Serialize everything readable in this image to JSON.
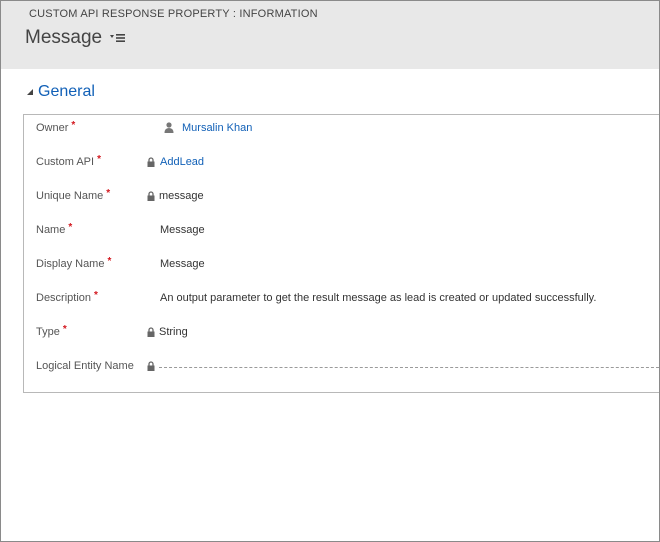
{
  "header": {
    "entity_label": "CUSTOM API RESPONSE PROPERTY : INFORMATION",
    "record_title": "Message"
  },
  "section": {
    "title": "General"
  },
  "fields": {
    "owner": {
      "label": "Owner",
      "required": "*",
      "value": "Mursalin Khan"
    },
    "custom_api": {
      "label": "Custom API",
      "required": "*",
      "value": "AddLead"
    },
    "unique_name": {
      "label": "Unique Name",
      "required": "*",
      "value": "message"
    },
    "name": {
      "label": "Name",
      "required": "*",
      "value": "Message"
    },
    "display_name": {
      "label": "Display Name",
      "required": "*",
      "value": "Message"
    },
    "description": {
      "label": "Description",
      "required": "*",
      "value": "An output parameter to get the result message as lead is created or updated successfully."
    },
    "type": {
      "label": "Type",
      "required": "*",
      "value": "String"
    },
    "logical_entity_name": {
      "label": "Logical Entity Name",
      "value": ""
    }
  },
  "colors": {
    "header_bg": "#e8e8e8",
    "link": "#1160b7",
    "required": "#d3181f",
    "border": "#b8b8b8"
  },
  "icons": {
    "form_menu": "form-menu-icon",
    "collapse": "collapse-triangle-icon",
    "lock": "lock-icon",
    "user": "user-icon"
  }
}
